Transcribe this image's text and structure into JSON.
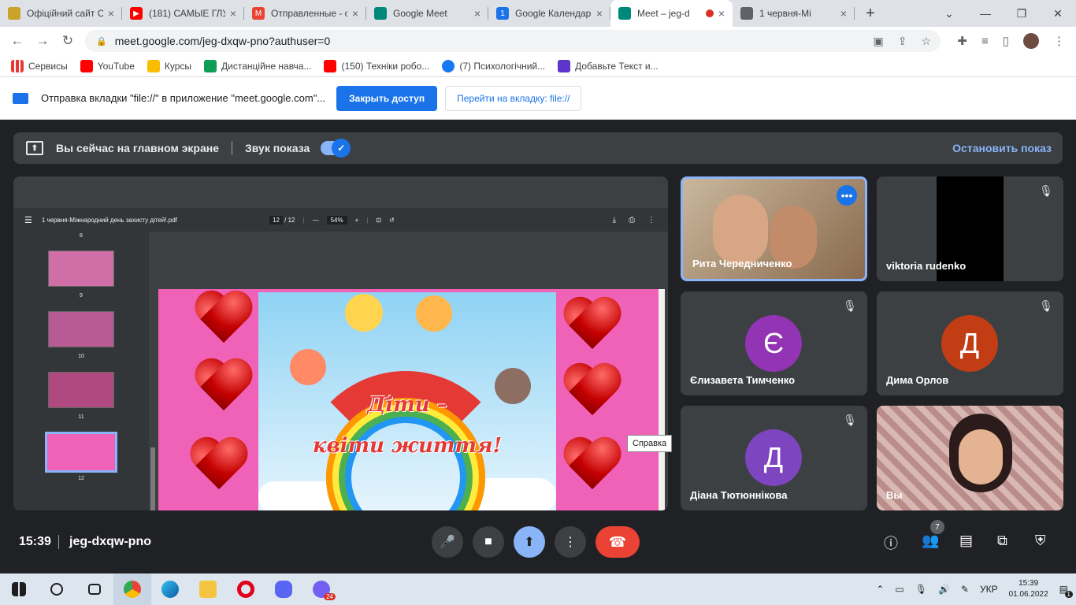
{
  "tabs": [
    {
      "title": "Офіційний сайт С",
      "icon_color": "#c9a227",
      "icon": "crest-icon"
    },
    {
      "title": "(181) САМЫЕ ГЛУ",
      "icon_color": "#ff0000",
      "icon": "youtube-icon"
    },
    {
      "title": "Отправленные - c",
      "icon_color": "#ea4335",
      "icon": "gmail-icon"
    },
    {
      "title": "Google Meet",
      "icon_color": "#00897b",
      "icon": "meet-icon"
    },
    {
      "title": "Google Календарь",
      "icon_color": "#1a73e8",
      "icon": "calendar-icon"
    },
    {
      "title": "Meet – jeg-d",
      "icon_color": "#00897b",
      "icon": "meet-icon",
      "active": true
    },
    {
      "title": "1 червня-Мі",
      "icon_color": "#5f6368",
      "icon": "globe-icon"
    }
  ],
  "address": {
    "url": "meet.google.com/jeg-dxqw-pno?authuser=0"
  },
  "bookmarks": [
    {
      "label": "Сервисы",
      "color": "#e53935"
    },
    {
      "label": "YouTube",
      "color": "#ff0000"
    },
    {
      "label": "Курсы",
      "color": "#fbbc04"
    },
    {
      "label": "Дистанційне навча...",
      "color": "#0f9d58"
    },
    {
      "label": "(150) Техніки робо...",
      "color": "#ff0000"
    },
    {
      "label": "(7) Психологічний...",
      "color": "#1877f2"
    },
    {
      "label": "Добавьте Текст и...",
      "color": "#5c35cc"
    }
  ],
  "infobar": {
    "message": "Отправка вкладки \"file://\" в приложение \"meet.google.com\"...",
    "primary": "Закрыть доступ",
    "secondary": "Перейти на вкладку: file://"
  },
  "sharebar": {
    "text": "Вы сейчас на главном экране",
    "audio": "Звук показа",
    "stop": "Остановить показ"
  },
  "pdf": {
    "filename": "1 червня-Міжнародний день захисту дітей!.pdf",
    "page": "12",
    "total": "/ 12",
    "zoom": "54%",
    "thumb_numbers": [
      "8",
      "9",
      "10",
      "11",
      "12"
    ],
    "slide_title_1": "Діти –",
    "slide_title_2": "квіти життя!"
  },
  "participants": [
    {
      "name": "Рита Чередниченко"
    },
    {
      "name": "viktoria rudenko"
    },
    {
      "name": "Єлизавета Тимченко",
      "initial": "Є",
      "color": "#9334b5"
    },
    {
      "name": "Дима Орлов",
      "initial": "Д",
      "color": "#c33d14"
    },
    {
      "name": "Діана Тютюннікова",
      "initial": "Д",
      "color": "#7e45c0"
    },
    {
      "name": "Вы"
    }
  ],
  "tooltip": "Справка",
  "bottom": {
    "time": "15:39",
    "code": "jeg-dxqw-pno",
    "people_count": "7"
  },
  "taskbar": {
    "lang": "УКР",
    "time": "15:39",
    "date": "01.06.2022",
    "viber_badge": "24",
    "notif": "1"
  }
}
